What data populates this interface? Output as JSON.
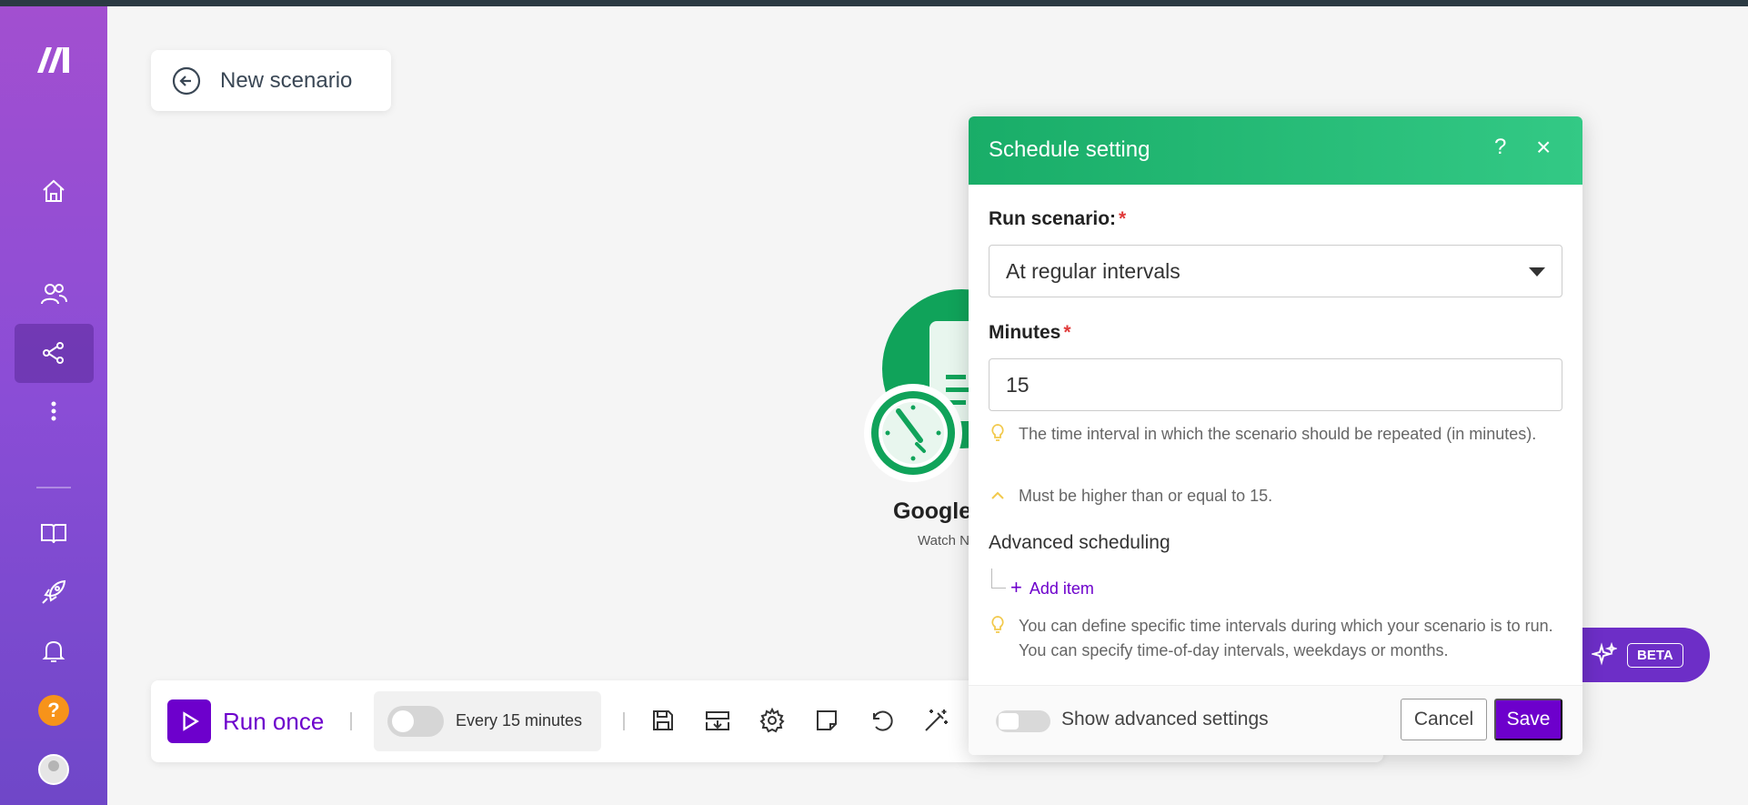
{
  "scenario": {
    "title": "New scenario"
  },
  "module": {
    "name": "Google",
    "subtitle": "Watch N"
  },
  "toolbar": {
    "run_once_label": "Run once",
    "schedule_label": "Every 15 minutes",
    "beta_label": "BETA"
  },
  "sidebar": {
    "help_label": "?"
  },
  "dialog": {
    "title": "Schedule setting",
    "help": "?",
    "close": "×",
    "run_scenario_label": "Run scenario:",
    "required_mark": "*",
    "run_scenario_value": "At regular intervals",
    "minutes_label": "Minutes",
    "minutes_value": "15",
    "minutes_hint": "The time interval in which the scenario should be repeated (in minutes).",
    "minutes_validation": "Must be higher than or equal to 15.",
    "advanced_label": "Advanced scheduling",
    "add_item_label": "Add item",
    "advanced_hint": "You can define specific time intervals during which your scenario is to run. You can specify time-of-day intervals, weekdays or months.",
    "show_advanced_label": "Show advanced settings",
    "cancel_label": "Cancel",
    "save_label": "Save"
  },
  "colors": {
    "brand_purple": "#6d00cc",
    "header_green": "#19ad68",
    "module_green": "#10a35a",
    "help_orange": "#f7931a"
  }
}
